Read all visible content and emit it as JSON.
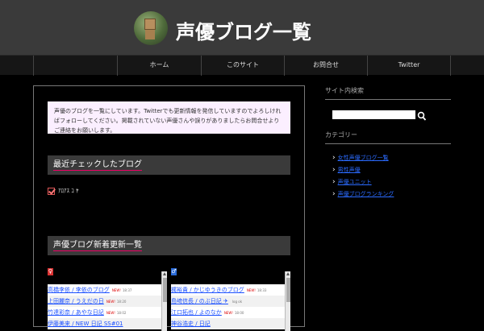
{
  "header": {
    "title": "声優ブログ一覧"
  },
  "nav": {
    "items": [
      "ホーム",
      "このサイト",
      "お問合せ",
      "Twitter"
    ]
  },
  "main": {
    "intro": "声優のブログを一覧にしています。Twitterでも更新情報を発信していますのでよろしければフォローしてください。掲載されていない声優さんや誤りがありましたらお問合せよりご連絡をお願いします。",
    "section1": {
      "title": "最近チェックしたブログ",
      "check_text": "ｱﾛｱｽ ｺ ﾔ"
    },
    "section2": {
      "title": "声優ブログ新着更新一覧",
      "female_icon": "♀",
      "male_icon": "♂",
      "female_rows": [
        {
          "name": "高橋李依 / 李依のブログ",
          "badge": "NEW!",
          "time": "18:37"
        },
        {
          "name": "上田麗奈 / うえだの日",
          "badge": "NEW!",
          "time": "18:20"
        },
        {
          "name": "竹達彩奈 / あやな日記",
          "badge": "NEW!",
          "time": "18:02"
        },
        {
          "name": "伊藤美来 / NEW 日記 SS#01",
          "badge": "",
          "time": ""
        }
      ],
      "male_rows": [
        {
          "name": "梶裕貴 / かじゆうきのブログ",
          "badge": "NEW!",
          "time": "18:33"
        },
        {
          "name": "島﨑信長 / のぶ日記 ✈",
          "badge": "",
          "time": "log ok"
        },
        {
          "name": "江口拓也 / よのなか",
          "badge": "NEW!",
          "time": "18:00"
        },
        {
          "name": "神谷浩史 / 日記",
          "badge": "",
          "time": ""
        }
      ]
    }
  },
  "sidebar": {
    "search_heading": "サイト内検索",
    "search_placeholder": "",
    "category_heading": "カテゴリー",
    "links": [
      "女性声優ブログ一覧",
      "男性声優",
      "声優ユニット",
      "声優ブログランキング"
    ]
  }
}
